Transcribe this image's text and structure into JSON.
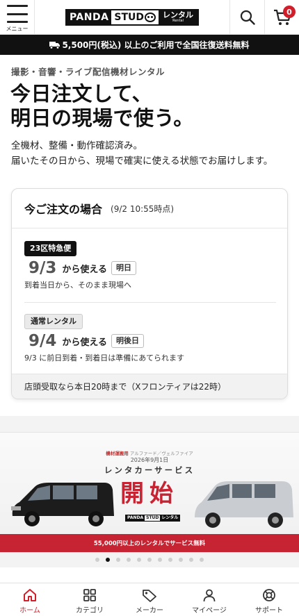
{
  "header": {
    "menu_label": "メニュー",
    "logo_panda": "PANDA",
    "logo_studio": "STUD",
    "logo_rental_jp": "レンタル",
    "logo_rental_en": "Rental",
    "cart_count": "0"
  },
  "shipping_banner": {
    "text": "5,500円(税込) 以上のご利用で全国往復送料無料",
    "icon": "truck-icon"
  },
  "hero": {
    "eyebrow": "撮影・音響・ライブ配信機材レンタル",
    "headline_line1": "今日注文して、",
    "headline_line2": "明日の現場で使う。",
    "lead_line1": "全機材、整備・動作確認済み。",
    "lead_line2": "届いたその日から、現場で確実に使える状態でお届けします。"
  },
  "order_card": {
    "title": "今ご注文の場合",
    "timestamp": "(9/2 10:55時点)",
    "options": [
      {
        "tag": "23区特急便",
        "date": "9/3",
        "use_label": "から使える",
        "chip": "明日",
        "note": "到着当日から、そのまま現場へ"
      },
      {
        "tag": "通常レンタル",
        "date": "9/4",
        "use_label": "から使える",
        "chip": "明後日",
        "note": "9/3 に前日到着・到着日は準備にあてられます"
      }
    ],
    "footer": "店頭受取なら本日20時まで（Xフロンティアは22時）"
  },
  "carousel": {
    "banner_line1_prefix": "機材運搬用",
    "banner_line1_rest": "アルファード／ヴェルファイア",
    "banner_line2": "2026年9月1日",
    "banner_line3": "レンタカーサービス",
    "banner_big": "開始",
    "banner_strip": "55,000円以上のレンタルでサービス無料",
    "total_slides": 11,
    "active_slide": 2
  },
  "bottom_nav": {
    "items": [
      {
        "label": "ホーム",
        "icon": "home-icon",
        "active": true
      },
      {
        "label": "カテゴリ",
        "icon": "grid-icon",
        "active": false
      },
      {
        "label": "メーカー",
        "icon": "tag-icon",
        "active": false
      },
      {
        "label": "マイページ",
        "icon": "user-icon",
        "active": false
      },
      {
        "label": "サポート",
        "icon": "lifebuoy-icon",
        "active": false
      }
    ]
  },
  "colors": {
    "accent_red": "#d01e2a",
    "dark": "#111111"
  }
}
